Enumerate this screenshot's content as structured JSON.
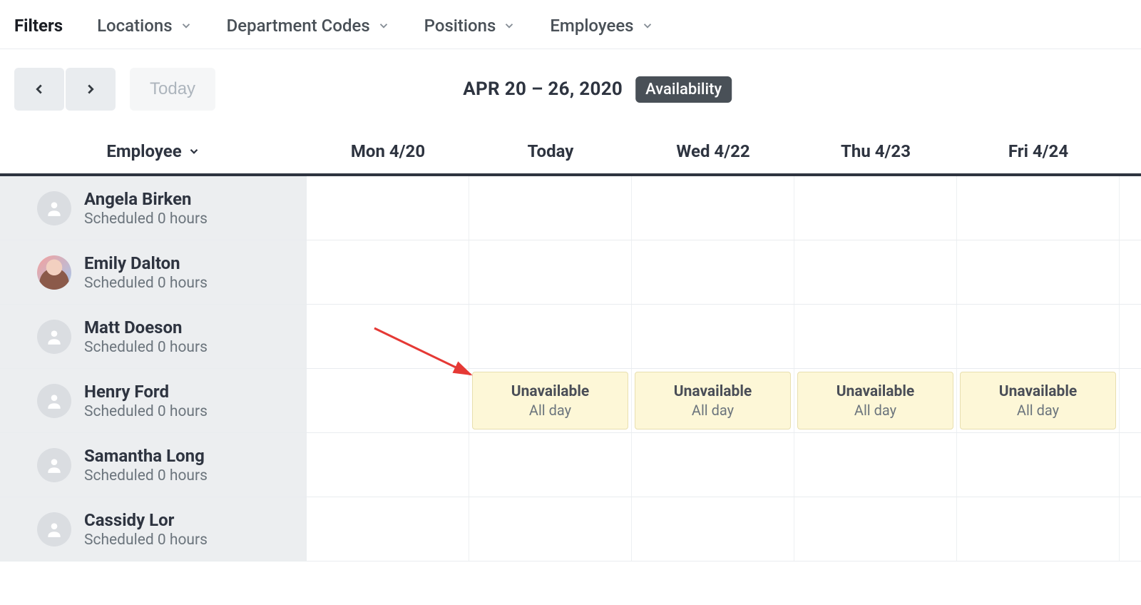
{
  "filters": {
    "label": "Filters",
    "items": [
      "Locations",
      "Department Codes",
      "Positions",
      "Employees"
    ]
  },
  "toolbar": {
    "today_label": "Today",
    "date_range": "APR 20 – 26, 2020",
    "badge": "Availability"
  },
  "columns": {
    "employee_header": "Employee",
    "days": [
      "Mon 4/20",
      "Today",
      "Wed 4/22",
      "Thu 4/23",
      "Fri 4/24"
    ]
  },
  "employees": [
    {
      "name": "Angela Birken",
      "sub": "Scheduled 0 hours",
      "has_photo": false
    },
    {
      "name": "Emily Dalton",
      "sub": "Scheduled 0 hours",
      "has_photo": true
    },
    {
      "name": "Matt Doeson",
      "sub": "Scheduled 0 hours",
      "has_photo": false
    },
    {
      "name": "Henry Ford",
      "sub": "Scheduled 0 hours",
      "has_photo": false
    },
    {
      "name": "Samantha Long",
      "sub": "Scheduled 0 hours",
      "has_photo": false
    },
    {
      "name": "Cassidy Lor",
      "sub": "Scheduled 0 hours",
      "has_photo": false
    }
  ],
  "unavailable": {
    "title": "Unavailable",
    "detail": "All day",
    "row_index": 3,
    "day_indices": [
      1,
      2,
      3,
      4
    ]
  }
}
